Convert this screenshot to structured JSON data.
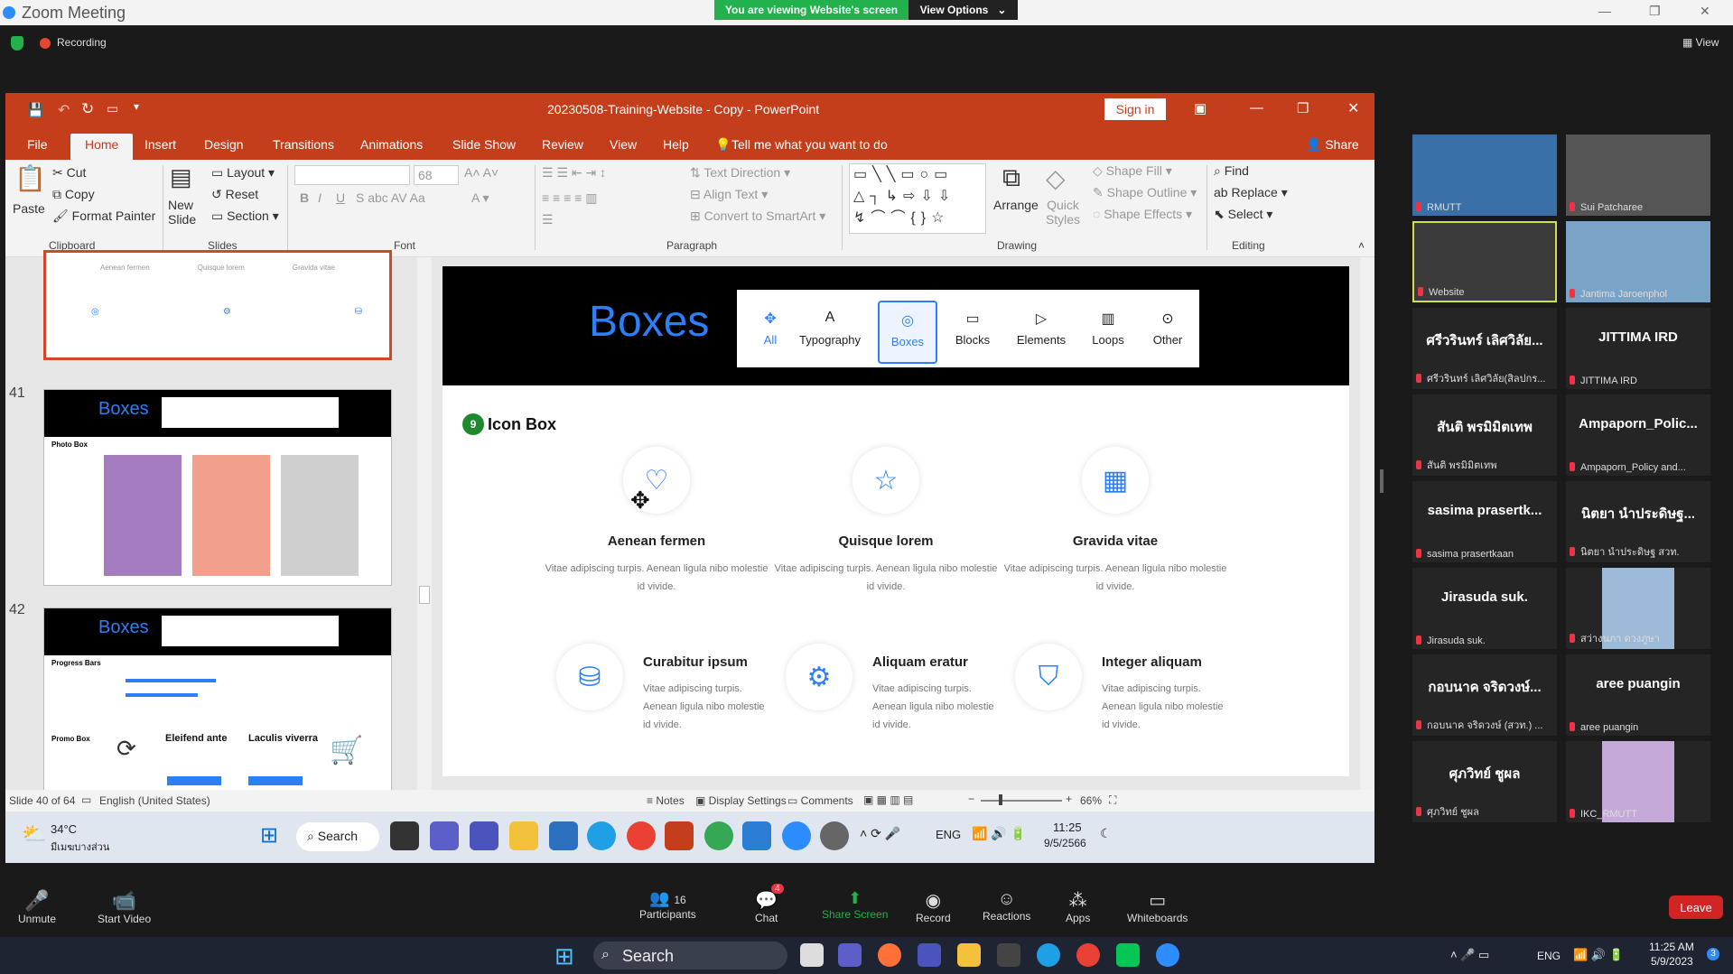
{
  "zoom": {
    "title": "Zoom Meeting",
    "viewing_text": "You are viewing Website's screen",
    "view_options": "View Options",
    "recording": "Recording",
    "view": "View",
    "toolbar": {
      "unmute": "Unmute",
      "start_video": "Start Video",
      "participants": "Participants",
      "participants_count": "16",
      "chat": "Chat",
      "chat_badge": "4",
      "share": "Share Screen",
      "record": "Record",
      "reactions": "Reactions",
      "apps": "Apps",
      "whiteboards": "Whiteboards",
      "leave": "Leave"
    },
    "gallery": [
      {
        "name": "",
        "sub": "RMUTT",
        "video": true
      },
      {
        "name": "",
        "sub": "Sui Patcharee",
        "video": true
      },
      {
        "name": "",
        "sub": "Website",
        "video": true
      },
      {
        "name": "",
        "sub": "Jantima Jaroenphol",
        "video": true
      },
      {
        "name": "ศรีวรินทร์ เลิศวิลัย...",
        "sub": "ศรีวรินทร์ เลิศวิลัย(สิลปกร..."
      },
      {
        "name": "JITTIMA IRD",
        "sub": "JITTIMA IRD"
      },
      {
        "name": "สันติ พรมิมิตเทพ",
        "sub": "สันติ พรมิมิตเทพ"
      },
      {
        "name": "Ampaporn_Polic...",
        "sub": "Ampaporn_Policy and..."
      },
      {
        "name": "sasima prasertk...",
        "sub": "sasima prasertkaan"
      },
      {
        "name": "นิตยา นำประดิษฐ...",
        "sub": "นิตยา นำประดิษฐ สวท."
      },
      {
        "name": "Jirasuda suk.",
        "sub": "Jirasuda suk."
      },
      {
        "name": "",
        "sub": "สว่างนภา ดวงภูษา",
        "video": true
      },
      {
        "name": "กอบนาค จริดวงษ์...",
        "sub": "กอบนาค จริดวงษ์ (สวท.) ..."
      },
      {
        "name": "aree puangin",
        "sub": "aree puangin"
      },
      {
        "name": "ศุภวิทย์ ชูผล",
        "sub": "ศุภวิทย์ ชูผล"
      },
      {
        "name": "",
        "sub": "IKC_RMUTT",
        "video": true
      }
    ]
  },
  "ppt": {
    "doc_title": "20230508-Training-Website - Copy  -  PowerPoint",
    "sign_in": "Sign in",
    "share": "Share",
    "tabs": [
      "File",
      "Home",
      "Insert",
      "Design",
      "Transitions",
      "Animations",
      "Slide Show",
      "Review",
      "View",
      "Help"
    ],
    "tell_me": "Tell me what you want to do",
    "ribbon": {
      "paste": "Paste",
      "cut": "Cut",
      "copy": "Copy",
      "format_painter": "Format Painter",
      "clipboard": "Clipboard",
      "new_slide": "New Slide",
      "layout": "Layout",
      "reset": "Reset",
      "section": "Section",
      "slides": "Slides",
      "font_size": "68",
      "font": "Font",
      "text_direction": "Text Direction",
      "align_text": "Align Text",
      "convert_smartart": "Convert to SmartArt",
      "paragraph": "Paragraph",
      "arrange": "Arrange",
      "quick_styles": "Quick Styles",
      "shape_fill": "Shape Fill",
      "shape_outline": "Shape Outline",
      "shape_effects": "Shape Effects",
      "drawing": "Drawing",
      "find": "Find",
      "replace": "Replace",
      "select": "Select",
      "editing": "Editing"
    },
    "thumbs": [
      {
        "num": "41",
        "title": "Boxes",
        "caption": "Photo Box"
      },
      {
        "num": "42",
        "title": "Boxes",
        "caption": "Progress Bars",
        "caption2": "Promo Box",
        "t1": "Eleifend ante",
        "t2": "Laculis viverra"
      }
    ],
    "slide": {
      "title": "Boxes",
      "tabs": [
        "All",
        "Typography",
        "Boxes",
        "Blocks",
        "Elements",
        "Loops",
        "Other"
      ],
      "section_num": "9",
      "section": "Icon Box",
      "cards_top": [
        {
          "icon": "heart-icon",
          "title": "Aenean fermen",
          "desc": "Vitae adipiscing turpis. Aenean ligula nibo molestie id vivide."
        },
        {
          "icon": "star-icon",
          "title": "Quisque lorem",
          "desc": "Vitae adipiscing turpis. Aenean ligula nibo molestie id vivide."
        },
        {
          "icon": "calendar-icon",
          "title": "Gravida vitae",
          "desc": "Vitae adipiscing turpis. Aenean ligula nibo molestie id vivide."
        }
      ],
      "cards_bottom": [
        {
          "icon": "database-icon",
          "title": "Curabitur ipsum",
          "desc": "Vitae adipiscing turpis. Aenean ligula nibo molestie id vivide."
        },
        {
          "icon": "gear-icon",
          "title": "Aliquam eratur",
          "desc": "Vitae adipiscing turpis. Aenean ligula nibo molestie id vivide."
        },
        {
          "icon": "cup-icon",
          "title": "Integer aliquam",
          "desc": "Vitae adipiscing turpis. Aenean ligula nibo molestie id vivide."
        }
      ]
    },
    "status": {
      "slide": "Slide 40 of 64",
      "lang": "English (United States)",
      "notes": "Notes",
      "display": "Display Settings",
      "comments": "Comments",
      "zoom": "66%"
    },
    "inner_taskbar": {
      "temp": "34°C",
      "weather": "มีเมฆบางส่วน",
      "search": "Search",
      "lang": "ENG",
      "time": "11:25",
      "date": "9/5/2566"
    }
  },
  "win_taskbar": {
    "search": "Search",
    "lang": "ENG",
    "time": "11:25 AM",
    "date": "5/9/2023",
    "badge": "3"
  },
  "colors": {
    "ppt_red": "#c43e1c",
    "accent_blue": "#2d7ff9",
    "zoom_green": "#22b14c"
  }
}
